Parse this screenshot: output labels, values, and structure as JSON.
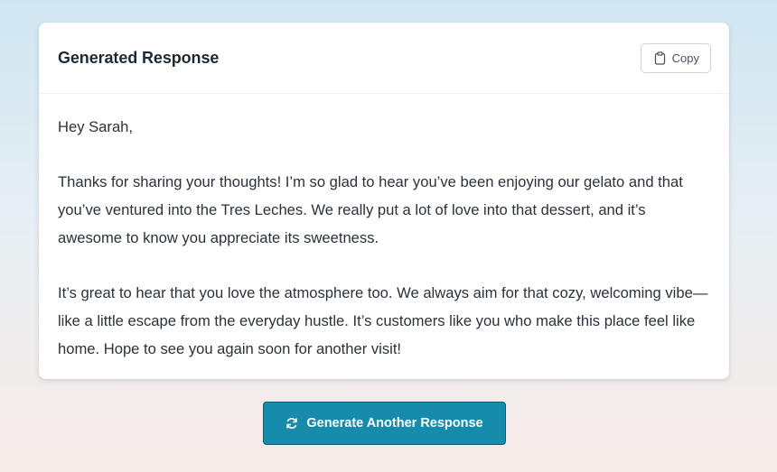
{
  "card": {
    "title": "Generated Response",
    "copy_label": "Copy",
    "copy_icon": "clipboard-icon"
  },
  "response": {
    "greeting": "Hey Sarah,",
    "paragraph_1": "Thanks for sharing your thoughts! I’m so glad to hear you’ve been enjoying our gelato and that you’ve ventured into the Tres Leches. We really put a lot of love into that dessert, and it’s awesome to know you appreciate its sweetness.",
    "paragraph_2": "It’s great to hear that you love the atmosphere too. We always aim for that cozy, welcoming vibe—like a little escape from the everyday hustle. It’s customers like you who make this place feel like home. Hope to see you again soon for another visit!"
  },
  "actions": {
    "generate_label": "Generate Another Response",
    "generate_icon": "refresh-icon"
  },
  "colors": {
    "accent": "#168bac",
    "accent_border": "#0b5e76",
    "card_bg": "#ffffff"
  }
}
